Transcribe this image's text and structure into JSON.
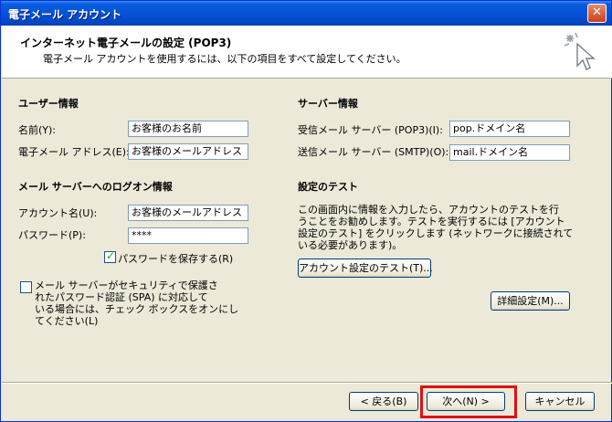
{
  "window": {
    "title": "電子メール アカウント"
  },
  "header": {
    "title": "インターネット電子メールの設定 (POP3)",
    "subtitle": "電子メール アカウントを使用するには、以下の項目をすべて設定してください。"
  },
  "user_info": {
    "heading": "ユーザー情報",
    "name_label": "名前(Y):",
    "name_value": "お客様のお名前",
    "email_label": "電子メール アドレス(E):",
    "email_value": "お客様のメールアドレス"
  },
  "server_info": {
    "heading": "サーバー情報",
    "incoming_label": "受信メール サーバー (POP3)(I):",
    "incoming_value": "pop.ドメイン名",
    "outgoing_label": "送信メール サーバー (SMTP)(O):",
    "outgoing_value": "mail.ドメイン名"
  },
  "logon_info": {
    "heading": "メール サーバーへのログオン情報",
    "account_label": "アカウント名(U):",
    "account_value": "お客様のメールアドレス",
    "password_label": "パスワード(P):",
    "password_value": "****",
    "remember_label": "パスワードを保存する(R)",
    "spa_line1": "メール サーバーがセキュリティで保護さ",
    "spa_line2": "れたパスワード認証 (SPA) に対応して",
    "spa_line3": "いる場合には、チェック ボックスをオンにし",
    "spa_line4": "てください(L)"
  },
  "test": {
    "heading": "設定のテスト",
    "line1": "この画面内に情報を入力したら、アカウントのテストを行",
    "line2": "うことをお勧めします。テストを実行するには [アカウント",
    "line3": "設定のテスト] をクリックします (ネットワークに接続されて",
    "line4": "いる必要があります)。",
    "test_button": "アカウント設定のテスト(T)...",
    "advanced_button": "詳細設定(M)..."
  },
  "footer": {
    "back": "< 戻る(B)",
    "next": "次へ(N) >",
    "cancel": "キャンセル"
  },
  "colors": {
    "highlight": "#e01010",
    "titlebar": "#0453d8"
  }
}
